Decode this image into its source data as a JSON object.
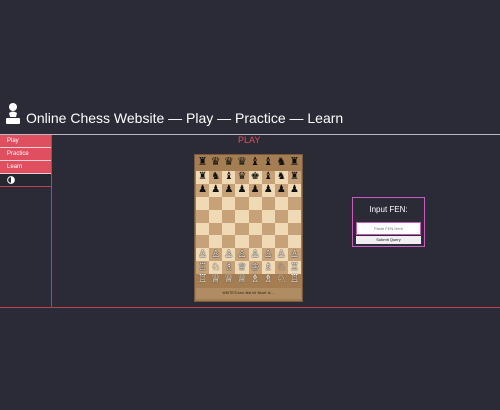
{
  "header": {
    "title": "Online Chess Website — Play — Practice — Learn",
    "logo_icon": "pawn-icon"
  },
  "sidebar": {
    "items": [
      {
        "label": "Play"
      },
      {
        "label": "Practice"
      },
      {
        "label": "Learn"
      }
    ],
    "theme_icon": "contrast-icon"
  },
  "main": {
    "heading": "PLAY"
  },
  "board": {
    "captured_top": [
      "♜",
      "♛",
      "♛",
      "♛",
      "♝",
      "♝",
      "♞",
      "♜"
    ],
    "captured_bottom": [
      "♖",
      "♕",
      "♕",
      "♕",
      "♗",
      "♗",
      "♘",
      "♖"
    ],
    "ranks": [
      "♜♞♝♛♚♝♞♜",
      "♟♟♟♟♟♟♟♟",
      "        ",
      "        ",
      "        ",
      "        ",
      "♙♙♙♙♙♙♙♙",
      "♖♘♗♕♔♗♘♖"
    ],
    "status": "WHITE'S turn: first hit 'Move' to ..."
  },
  "fen": {
    "title": "Input FEN:",
    "placeholder": "Paste FEN Here",
    "submit_label": "Submit Query"
  },
  "colors": {
    "background": "#2a2b36",
    "accent": "#e04f5f",
    "fen_border": "#c85cc0",
    "light_square": "#f0d9b5",
    "dark_square": "#c7a177"
  }
}
